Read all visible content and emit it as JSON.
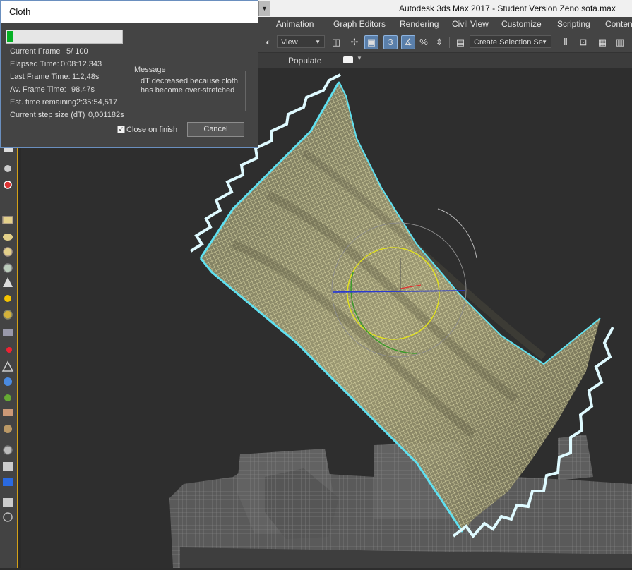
{
  "app": {
    "title": "Autodesk 3ds Max 2017 - Student Version    Zeno sofa.max"
  },
  "menu": [
    "Animation",
    "Graph Editors",
    "Rendering",
    "Civil View",
    "Customize",
    "Scripting",
    "Conten"
  ],
  "toolbar": {
    "view_dropdown": "View",
    "selection_set_dropdown": "Create Selection Se",
    "snap_label": "3"
  },
  "ribbon": {
    "populate": "Populate"
  },
  "cloth_dialog": {
    "title": "Cloth",
    "progress_fraction": 0.05,
    "stats": [
      {
        "label": "Current Frame",
        "value": "5/  100"
      },
      {
        "label": "Elapsed Time:",
        "value": "0:08:12,343"
      },
      {
        "label": "Last Frame Time:",
        "value": "112,48s"
      },
      {
        "label": "Av. Frame Time:",
        "value": "98,47s"
      },
      {
        "label": "Est. time remaining",
        "value": "2:35:54,517"
      },
      {
        "label": "Current step size (dT)",
        "value": "0,001182s"
      }
    ],
    "message_legend": "Message",
    "message": "dT decreased because cloth has become over-stretched",
    "close_on_finish_label": "Close on finish",
    "close_on_finish_checked": true,
    "cancel_label": "Cancel"
  },
  "colors": {
    "viewport_bg": "#2e2e2e",
    "cloth_wire": "#f2eeb8",
    "cloth_edge": "#5fe0f0",
    "gizmo_yellow": "#e0e020",
    "gizmo_green": "#3a9a2a",
    "gizmo_blue": "#2a3ad0",
    "progress_green": "#06b025"
  }
}
